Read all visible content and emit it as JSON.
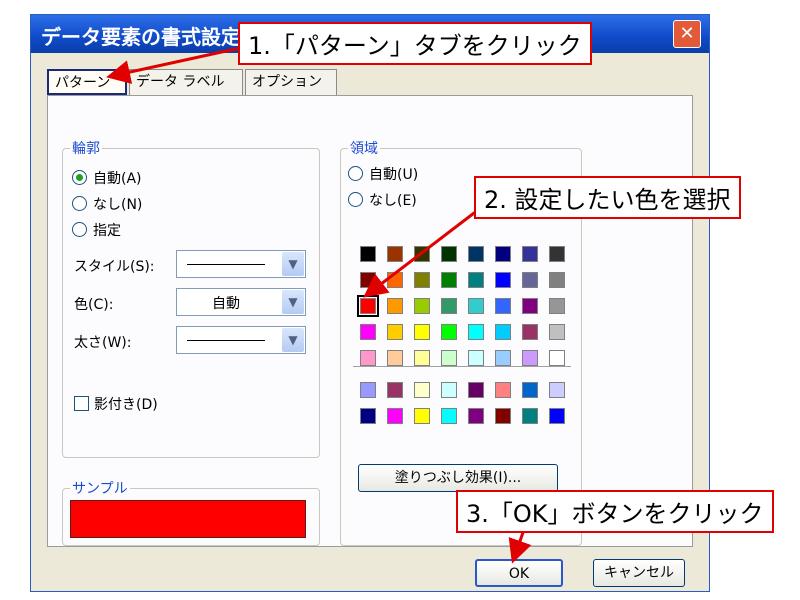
{
  "dialog": {
    "title": "データ要素の書式設定",
    "close_label": "✕"
  },
  "tabs": [
    {
      "label": "パターン",
      "active": true
    },
    {
      "label": "データ ラベル",
      "active": false
    },
    {
      "label": "オプション",
      "active": false
    }
  ],
  "border_group": {
    "label": "輪郭",
    "radios": [
      {
        "label": "自動(A)",
        "checked": true
      },
      {
        "label": "なし(N)",
        "checked": false
      },
      {
        "label": "指定",
        "checked": false
      }
    ],
    "style_label": "スタイル(S):",
    "color_label": "色(C):",
    "color_value": "自動",
    "weight_label": "太さ(W):",
    "shadow_label": "影付き(D)"
  },
  "area_group": {
    "label": "領域",
    "radios": [
      {
        "label": "自動(U)",
        "checked": true
      },
      {
        "label": "なし(E)",
        "checked": false
      }
    ],
    "fill_effects_label": "塗りつぶし効果(I)...",
    "selected_color": "#ff0000",
    "palette_rows": [
      [
        "#000000",
        "#993300",
        "#333300",
        "#003300",
        "#003366",
        "#000080",
        "#333399",
        "#333333"
      ],
      [
        "#800000",
        "#ff6600",
        "#808000",
        "#008000",
        "#008080",
        "#0000ff",
        "#666699",
        "#808080"
      ],
      [
        "#ff0000",
        "#ff9900",
        "#99cc00",
        "#339966",
        "#33cccc",
        "#3366ff",
        "#800080",
        "#969696"
      ],
      [
        "#ff00ff",
        "#ffcc00",
        "#ffff00",
        "#00ff00",
        "#00ffff",
        "#00ccff",
        "#993366",
        "#c0c0c0"
      ],
      [
        "#ff99cc",
        "#ffcc99",
        "#ffff99",
        "#ccffcc",
        "#ccffff",
        "#99ccff",
        "#cc99ff",
        "#ffffff"
      ]
    ],
    "chart_palette_rows": [
      [
        "#9999ff",
        "#993366",
        "#ffffcc",
        "#ccffff",
        "#660066",
        "#ff8080",
        "#0066cc",
        "#ccccff"
      ],
      [
        "#000080",
        "#ff00ff",
        "#ffff00",
        "#00ffff",
        "#800080",
        "#800000",
        "#008080",
        "#0000ff"
      ]
    ]
  },
  "sample_group": {
    "label": "サンプル",
    "color": "#ff0000"
  },
  "buttons": {
    "ok": "OK",
    "cancel": "キャンセル"
  },
  "callouts": {
    "step1": "1.「パターン」タブをクリック",
    "step2": "2. 設定したい色を選択",
    "step3": "3.「OK」ボタンをクリック"
  },
  "colors": {
    "callout_border": "#e00000",
    "title_bar": "#0f4ac8",
    "group_label": "#1b4bd0"
  }
}
